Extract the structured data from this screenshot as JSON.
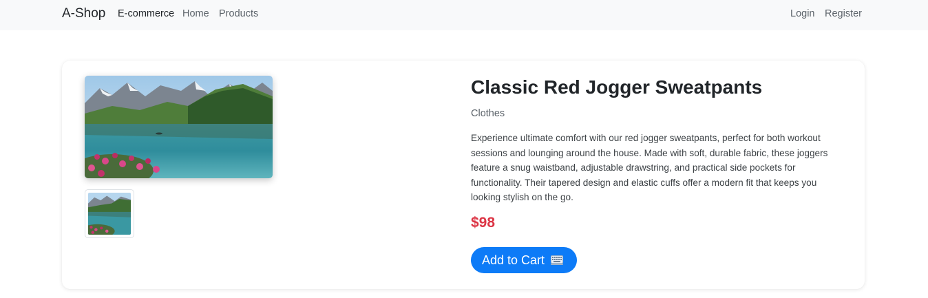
{
  "navbar": {
    "brand": "A-Shop",
    "links": [
      "E-commerce",
      "Home",
      "Products"
    ],
    "auth": [
      "Login",
      "Register"
    ]
  },
  "product": {
    "title": "Classic Red Jogger Sweatpants",
    "category": "Clothes",
    "description": "Experience ultimate comfort with our red jogger sweatpants, perfect for both workout sessions and lounging around the house. Made with soft, durable fabric, these joggers feature a snug waistband, adjustable drawstring, and practical side pockets for functionality. Their tapered design and elastic cuffs offer a modern fit that keeps you looking stylish on the go.",
    "price": "$98",
    "add_to_cart_label": "Add to Cart",
    "add_to_cart_icon": "keyboard-icon",
    "image": "mountain-lake-image"
  },
  "colors": {
    "price": "#dc3545",
    "button": "#0d7bf7",
    "navbar_bg": "#f8f9fa"
  }
}
